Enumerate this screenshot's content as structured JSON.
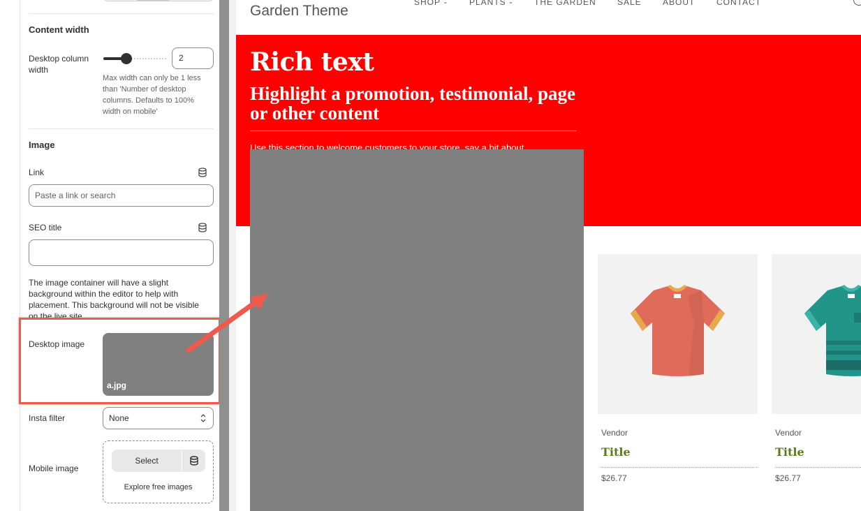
{
  "panel": {
    "content_width": {
      "title": "Content width",
      "desktop_column_label": "Desktop column width",
      "desktop_column_value": "2",
      "slider_fraction": 0.37,
      "hint": "Max width can only be 1 less than 'Number of desktop columns. Defaults to 100% width on mobile'"
    },
    "image": {
      "title": "Image",
      "link_label": "Link",
      "link_placeholder": "Paste a link or search",
      "seo_label": "SEO title",
      "seo_value": "",
      "info": "The image container will have a slight background within the editor to help with placement. This background will not be visible on the live site.",
      "desktop_image_label": "Desktop image",
      "desktop_image_file": "a.jpg",
      "insta_filter_label": "Insta filter",
      "insta_filter_value": "None",
      "mobile_image_label": "Mobile image",
      "select_label": "Select",
      "explore_label": "Explore free images"
    }
  },
  "preview": {
    "store_name": "Garden Theme",
    "nav": [
      {
        "label": "SHOP",
        "has_dropdown": true
      },
      {
        "label": "PLANTS",
        "has_dropdown": true
      },
      {
        "label": "THE GARDEN",
        "has_dropdown": false
      },
      {
        "label": "SALE",
        "has_dropdown": false
      },
      {
        "label": "ABOUT",
        "has_dropdown": false
      },
      {
        "label": "CONTACT",
        "has_dropdown": false
      }
    ],
    "hero": {
      "heading": "Rich text",
      "subheading": "Highlight a promotion, testimonial, page or other content",
      "body": "Use this section to welcome customers to your store, say a bit about",
      "background_color": "#ff0000"
    },
    "products": [
      {
        "vendor": "Vendor",
        "title": "Title",
        "price": "$26.77",
        "shirt_color": "#e06b5a",
        "collar_color": "#e8a94a"
      },
      {
        "vendor": "Vendor",
        "title": "Title",
        "price": "$26.77",
        "shirt_color": "#21958a",
        "collar_color": "#3bb3a6"
      }
    ]
  },
  "annotations": {
    "highlight_color": "#ef5a4c"
  }
}
